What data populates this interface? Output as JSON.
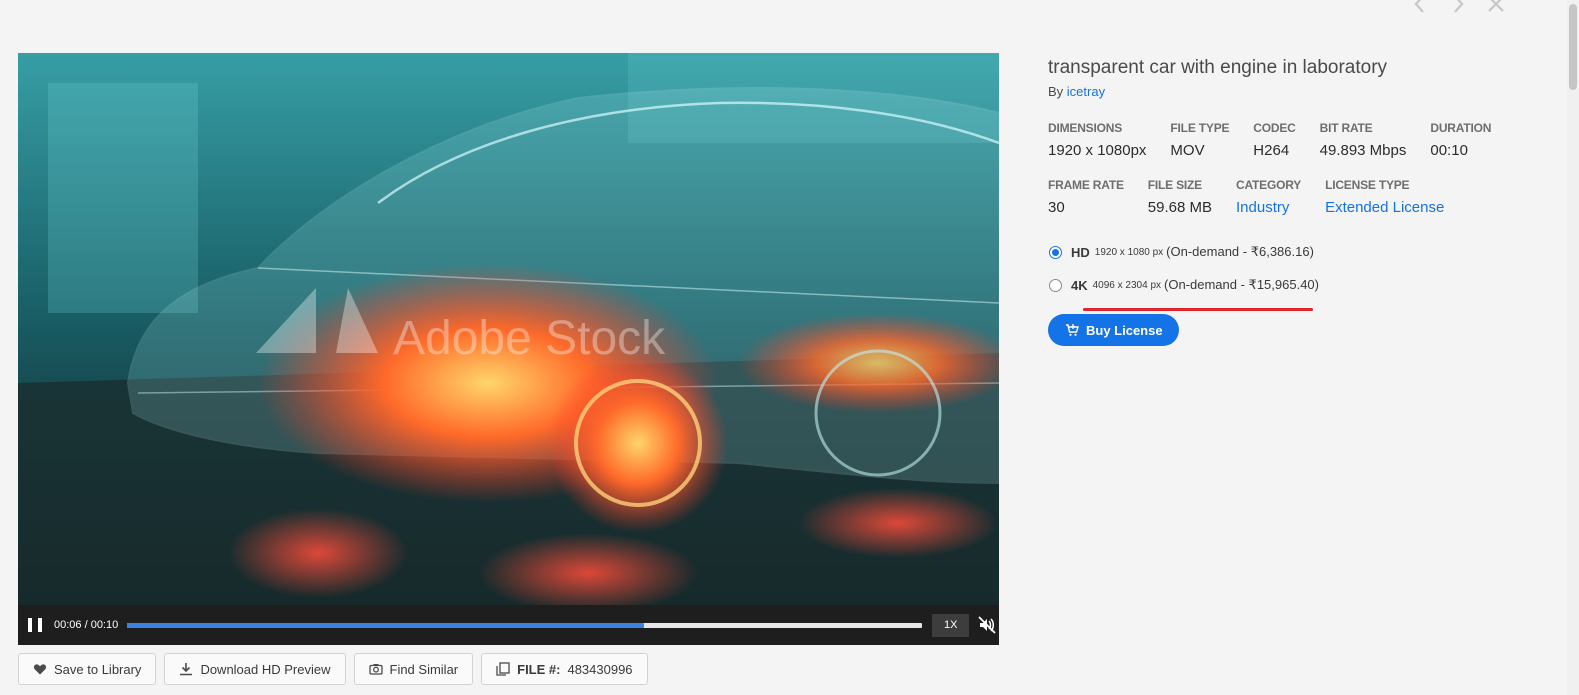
{
  "nav": {
    "prev_icon": "chevron-left-icon",
    "next_icon": "chevron-right-icon",
    "close_icon": "close-icon"
  },
  "video": {
    "watermark": "Adobe Stock",
    "time_label": "00:06 / 00:10",
    "progress_percent": 65,
    "speed_label": "1X",
    "muted": true
  },
  "actions": {
    "save_label": "Save to Library",
    "download_label": "Download HD Preview",
    "similar_label": "Find Similar",
    "file_label": "FILE #:",
    "file_number": "483430996"
  },
  "asset": {
    "title": "transparent car with engine in laboratory",
    "by_prefix": "By",
    "author": "icetray"
  },
  "meta_row1": [
    {
      "key": "DIMENSIONS",
      "value": "1920 x 1080px"
    },
    {
      "key": "FILE TYPE",
      "value": "MOV"
    },
    {
      "key": "CODEC",
      "value": "H264"
    },
    {
      "key": "BIT RATE",
      "value": "49.893 Mbps"
    },
    {
      "key": "DURATION",
      "value": "00:10"
    }
  ],
  "meta_row2": [
    {
      "key": "FRAME RATE",
      "value": "30"
    },
    {
      "key": "FILE SIZE",
      "value": "59.68 MB"
    },
    {
      "key": "CATEGORY",
      "value": "Industry"
    },
    {
      "key": "LICENSE TYPE",
      "value": "Extended License"
    }
  ],
  "options": [
    {
      "res": "HD",
      "px": "1920 x 1080 px",
      "price": "(On-demand - ₹6,386.16)",
      "selected": true
    },
    {
      "res": "4K",
      "px": "4096 x 2304 px",
      "price": "(On-demand - ₹15,965.40)",
      "selected": false
    }
  ],
  "buy_label": "Buy License",
  "colors": {
    "accent": "#1473e6",
    "highlight_underline": "#e0262c"
  }
}
